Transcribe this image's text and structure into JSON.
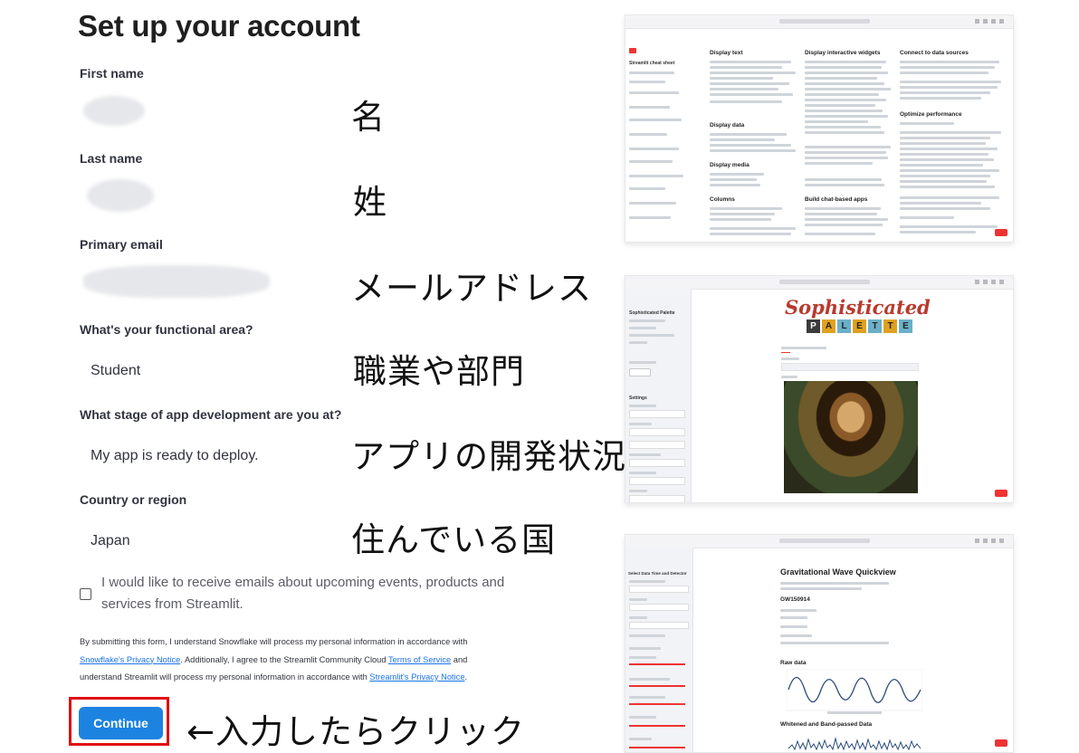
{
  "form": {
    "title": "Set up your account",
    "first_name_label": "First name",
    "last_name_label": "Last name",
    "email_label": "Primary email",
    "functional_area_label": "What's your functional area?",
    "functional_area_value": "Student",
    "stage_label": "What stage of app development are you at?",
    "stage_value": "My app is ready to deploy.",
    "country_label": "Country or region",
    "country_value": "Japan",
    "consent_text": "I would like to receive emails about upcoming events, products and services from Streamlit.",
    "legal_1": "By submitting this form, I understand Snowflake will process my personal information in accordance with",
    "legal_link_1": "Snowflake's Privacy Notice",
    "legal_2": ". Additionally, I agree to the Streamlit Community Cloud",
    "legal_link_2": "Terms of Service",
    "legal_3": " and",
    "legal_4": "understand Streamlit will process my personal information in accordance with",
    "legal_link_3": "Streamlit's Privacy Notice",
    "legal_5": ".",
    "continue_label": "Continue"
  },
  "annotations": {
    "first_name": "名",
    "last_name": "姓",
    "email": "メールアドレス",
    "functional_area": "職業や部門",
    "stage": "アプリの開発状況",
    "country": "住んでいる国",
    "continue": "←入力したらクリック"
  },
  "thumbnails": {
    "cheat_sheet": {
      "sidebar_title": "Streamlit cheat sheet",
      "col1": [
        "Display text",
        "Display data",
        "Display media",
        "Columns"
      ],
      "col2": [
        "Display interactive widgets",
        "Build chat-based apps"
      ],
      "col3": [
        "Connect to data sources",
        "Optimize performance"
      ]
    },
    "palette": {
      "sidebar_title": "Sophisticated Palette",
      "logo_top": "Sophisticated",
      "logo_letters": [
        "P",
        "A",
        "L",
        "E",
        "T",
        "T",
        "E"
      ],
      "settings": "Settings"
    },
    "gravitational": {
      "title": "Gravitational Wave Quickview",
      "event": "GW150914",
      "raw": "Raw data",
      "filtered": "Whitened and Band-passed Data",
      "sidebar_title": "Select Data Time and Detector"
    }
  },
  "colors": {
    "accent": "#1c83e1",
    "highlight": "#e01010",
    "link": "#1a73e8"
  }
}
